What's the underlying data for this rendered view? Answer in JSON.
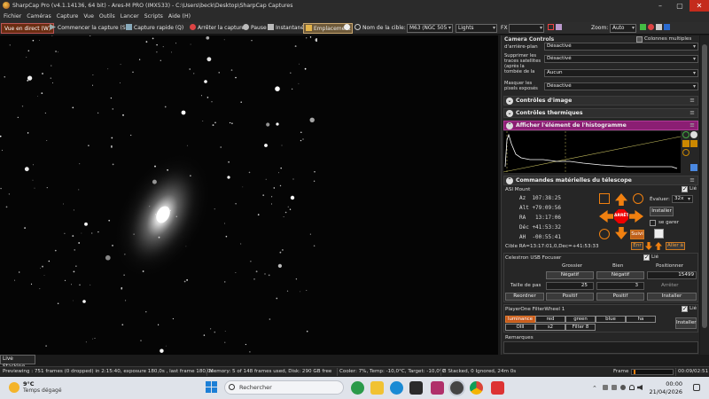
{
  "window": {
    "title": "SharpCap Pro (v4.1.14136, 64 bit) - Ares-M PRO (IMX533) - C:\\Users\\beck\\Desktop\\SharpCap Captures",
    "minimize": "–",
    "maximize": "▢",
    "close": "✕"
  },
  "menu": [
    "Fichier",
    "Caméras",
    "Capture",
    "Vue",
    "Outils",
    "Lancer",
    "Scripts",
    "Aide (H)"
  ],
  "toolbar": {
    "live": "Vue en direct (W)",
    "start_capture": "Commencer la capture (S)",
    "quick_capture": "Capture rapide (Q)",
    "stop_capture": "Arrêter la capture",
    "pause": "Pause",
    "snapshot": "Instantané",
    "location": "Emplacement",
    "target_label": "Nom de la cible:",
    "target_value": "M63 (NGC 505",
    "frame_type": "Lights",
    "fx_label": "FX",
    "zoom_label": "Zoom:",
    "zoom_value": "Auto"
  },
  "panel": {
    "camera_controls": "Camera Controls",
    "multi_columns": "Colonnes multiples",
    "bg_label": "d'arrière-plan",
    "bg_value": "Désactivé",
    "sat_label": "Supprimer les traces satellites (après la tombée de la nuit)",
    "sat_value": "Désactivé",
    "aucun_value": "Aucun",
    "mask_label": "Masquer les pixels exposés",
    "mask_value": "Désactivé",
    "image_controls": "Contrôles d'image",
    "thermal_controls": "Contrôles thermiques",
    "histogram": "Afficher l'élément de l'histogramme",
    "telescope": "Commandes matérielles du télescope",
    "mount": {
      "name": "ASI Mount",
      "linked": "Lié",
      "az": "Az  107:38:25",
      "alt": "Alt +79:09:56",
      "ra": "RA   13:17:06",
      "dec": "Déc +41:53:32",
      "ah": "AH  -00:55:41",
      "evaluate_label": "Évaluer:",
      "rate": "32x",
      "install": "Installer",
      "park": "se garer",
      "stop": "ARRÊT",
      "follow": "Suivi",
      "target": "Cible   RA=13:17:01,0,Dec=+41:53:33",
      "go": "Enr",
      "goto": "Aller à"
    },
    "focuser": {
      "name": "Celestron USB Focuser",
      "linked": "Lié",
      "coarse": "Grossier",
      "fine": "Bien",
      "position_label": "Positionner",
      "neg": "Négatif",
      "pos": "Positif",
      "position": "15499",
      "step_label": "Taille de pas",
      "coarse_step": "25",
      "fine_step": "3",
      "stop": "Arrêter",
      "reorder": "Reordner",
      "install": "Installer"
    },
    "filterwheel": {
      "name": "PlayerOne FilterWheel 1",
      "linked": "Lié",
      "filters": [
        "luminance",
        "red",
        "green",
        "blue",
        "ha",
        "OIII",
        "s2",
        "Filter 8"
      ],
      "install": "Installer"
    },
    "remarks": "Remarques"
  },
  "live_stacking": "Live Stacking",
  "status": {
    "previewing": "Previewing : 751 frames (0 dropped) in 2:15:40, exposure 180,0s , last frame 180,0s",
    "memory": "Memory: 5 of 148 frames used, Disk: 290 GB free",
    "cooler": "Cooler: 7%, Temp: -10,0°C, Target: -10,0°C",
    "stacked": "8 Stacked, 0 Ignored, 24m 0s",
    "frame_label": "Frame",
    "time": "00:09/02:51"
  },
  "taskbar": {
    "temp": "9°C",
    "weather": "Temps dégagé",
    "search": "Rechercher",
    "clock": "00:00",
    "date": "21/04/2026"
  }
}
